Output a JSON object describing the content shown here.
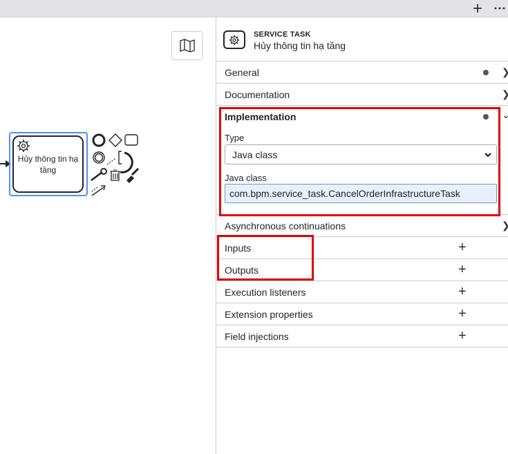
{
  "topbar": {
    "plus_icon": "plus-icon",
    "more_icon": "more-icon"
  },
  "canvas": {
    "task_label": "Hủy thông tin hạ tầng",
    "colors": {
      "selection": "#4d90fe",
      "stroke": "#22242a"
    }
  },
  "panel": {
    "header": {
      "type": "SERVICE TASK",
      "name": "Hủy thông tin hạ tầng"
    },
    "groups": {
      "general": "General",
      "documentation": "Documentation",
      "implementation": "Implementation",
      "async": "Asynchronous continuations",
      "inputs": "Inputs",
      "outputs": "Outputs",
      "execution_listeners": "Execution listeners",
      "extension_properties": "Extension properties",
      "field_injections": "Field injections"
    },
    "implementation": {
      "type_label": "Type",
      "type_value": "Java class",
      "class_label": "Java class",
      "class_value": "com.bpm.service_task.CancelOrderInfrastructureTask"
    }
  },
  "annotation_color": "#e00000"
}
